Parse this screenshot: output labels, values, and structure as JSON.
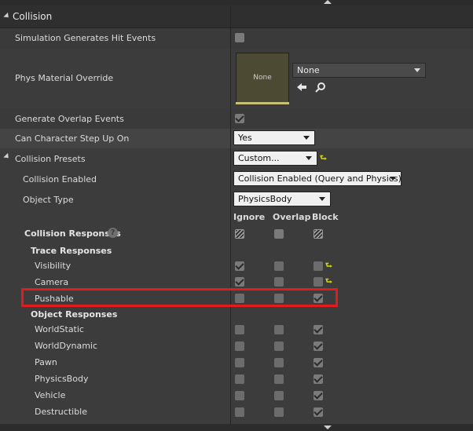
{
  "section": {
    "title": "Collision"
  },
  "props": {
    "sim_hit": {
      "label": "Simulation Generates Hit Events",
      "checked": false
    },
    "phys_material": {
      "label": "Phys Material Override",
      "thumb_label": "None",
      "dropdown_value": "None"
    },
    "overlap": {
      "label": "Generate Overlap Events",
      "checked": true
    },
    "step_up": {
      "label": "Can Character Step Up On",
      "value": "Yes"
    },
    "presets": {
      "label": "Collision Presets",
      "value": "Custom..."
    },
    "enabled": {
      "label": "Collision Enabled",
      "value": "Collision Enabled (Query and Physics)"
    },
    "object_type": {
      "label": "Object Type",
      "value": "PhysicsBody"
    }
  },
  "columns": {
    "ignore": "Ignore",
    "overlap": "Overlap",
    "block": "Block"
  },
  "responses": {
    "label": "Collision Responses",
    "trace_label": "Trace Responses",
    "object_label": "Object Responses",
    "trace": [
      {
        "label": "Visibility",
        "state": "ignore"
      },
      {
        "label": "Camera",
        "state": "ignore"
      },
      {
        "label": "Pushable",
        "state": "block"
      }
    ],
    "object": [
      {
        "label": "WorldStatic",
        "state": "block"
      },
      {
        "label": "WorldDynamic",
        "state": "block"
      },
      {
        "label": "Pawn",
        "state": "block"
      },
      {
        "label": "PhysicsBody",
        "state": "block"
      },
      {
        "label": "Vehicle",
        "state": "block"
      },
      {
        "label": "Destructible",
        "state": "block"
      }
    ]
  },
  "icons": {
    "collapse": "triangle-down-icon",
    "back": "arrow-left-icon",
    "browse": "magnifier-icon",
    "help": "question-circle-icon",
    "reset": "reset-arrow-icon"
  },
  "colors": {
    "highlight": "#e21c1c",
    "reset": "#d8d800"
  }
}
